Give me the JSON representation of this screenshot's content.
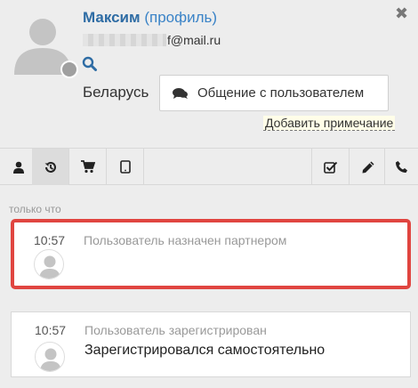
{
  "header": {
    "name": "Максим",
    "profile_link": "(профиль)",
    "email_suffix": "f@mail.ru",
    "country": "Беларусь",
    "chat_button": "Общение с пользователем",
    "add_note": "Добавить примечание",
    "close_symbol": "✖"
  },
  "feed": {
    "group_label": "только что",
    "events": [
      {
        "time": "10:57",
        "title": "Пользователь назначен партнером",
        "description": ""
      },
      {
        "time": "10:57",
        "title": "Пользователь зарегистрирован",
        "description": "Зарегистрировался самостоятельно"
      }
    ]
  },
  "colors": {
    "name": "#2e6ca4",
    "link": "#3a83c7",
    "highlight_border": "#e04540"
  }
}
